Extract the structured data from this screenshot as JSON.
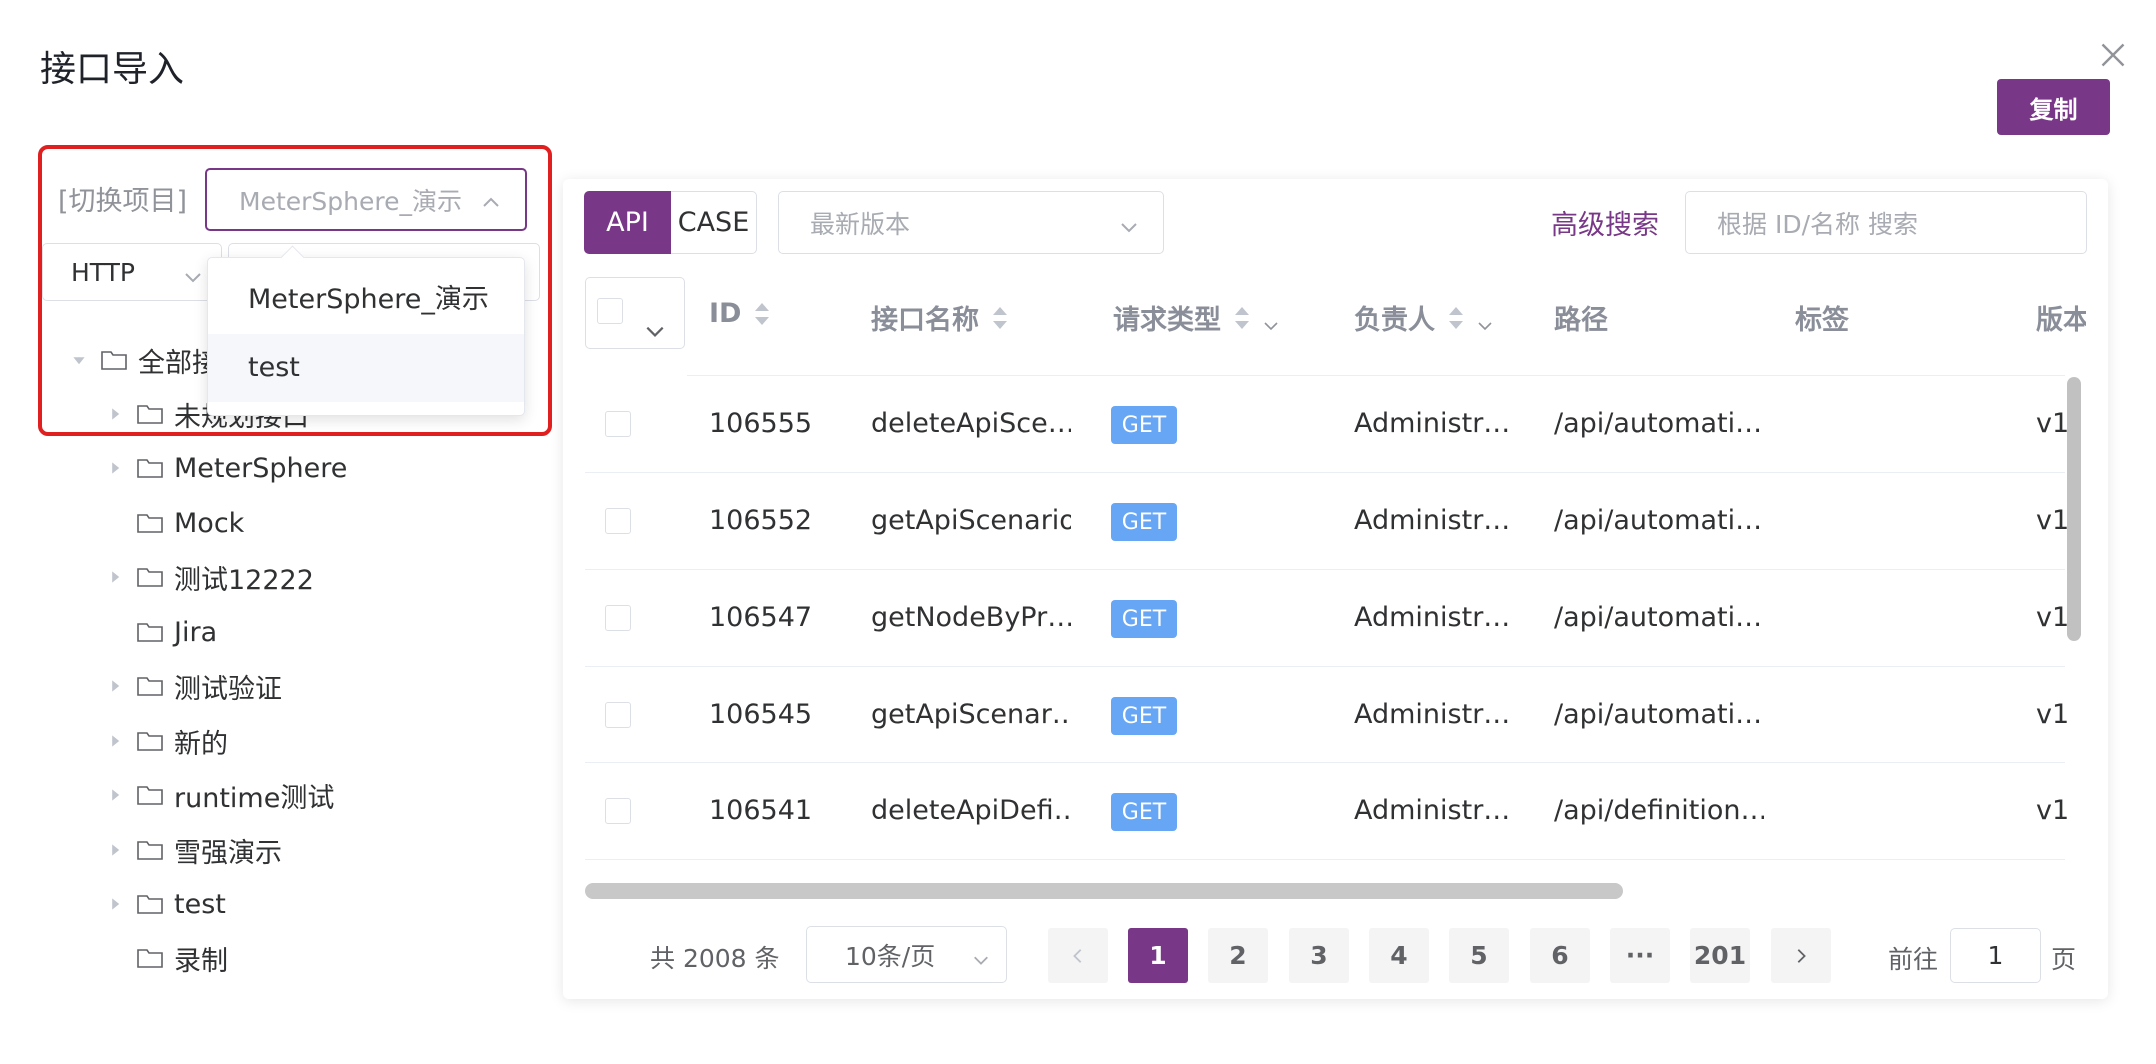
{
  "dialog": {
    "title": "接口导入",
    "copy_label": "复制"
  },
  "left": {
    "switch_label": "[切换项目]",
    "project_select_value": "MeterSphere_演示",
    "protocol_value": "HTTP",
    "project_options": [
      "MeterSphere_演示",
      "test"
    ],
    "tree": {
      "root": "全部接口",
      "children": [
        "未规划接口",
        "MeterSphere",
        "Mock",
        "测试12222",
        "Jira",
        "测试验证",
        "新的",
        "runtime测试",
        "雪强演示",
        "test",
        "录制"
      ]
    }
  },
  "toolbar": {
    "tab_api": "API",
    "tab_case": "CASE",
    "version_placeholder": "最新版本",
    "advanced_search": "高级搜索",
    "search_placeholder": "根据 ID/名称 搜索"
  },
  "table": {
    "columns": [
      "ID",
      "接口名称",
      "请求类型",
      "负责人",
      "路径",
      "标签",
      "版本"
    ],
    "rows": [
      {
        "id": "106555",
        "name": "deleteApiSce…",
        "method": "GET",
        "owner": "Administr…",
        "path": "/api/automati…",
        "tag": "",
        "version": "v1"
      },
      {
        "id": "106552",
        "name": "getApiScenario",
        "method": "GET",
        "owner": "Administr…",
        "path": "/api/automati…",
        "tag": "",
        "version": "v1"
      },
      {
        "id": "106547",
        "name": "getNodeByPr…",
        "method": "GET",
        "owner": "Administr…",
        "path": "/api/automati…",
        "tag": "",
        "version": "v1"
      },
      {
        "id": "106545",
        "name": "getApiScenar…",
        "method": "GET",
        "owner": "Administr…",
        "path": "/api/automati…",
        "tag": "",
        "version": "v1"
      },
      {
        "id": "106541",
        "name": "deleteApiDefi…",
        "method": "GET",
        "owner": "Administr…",
        "path": "/api/definition…",
        "tag": "",
        "version": "v1"
      }
    ]
  },
  "pagination": {
    "total": "共 2008 条",
    "page_size": "10条/页",
    "pages": [
      "1",
      "2",
      "3",
      "4",
      "5",
      "6",
      "···",
      "201"
    ],
    "current": "1",
    "goto_prefix": "前往",
    "goto_value": "1",
    "goto_suffix": "页"
  },
  "colors": {
    "accent": "#783887",
    "highlight": "#e02020",
    "method_get": "#66a6f5"
  }
}
